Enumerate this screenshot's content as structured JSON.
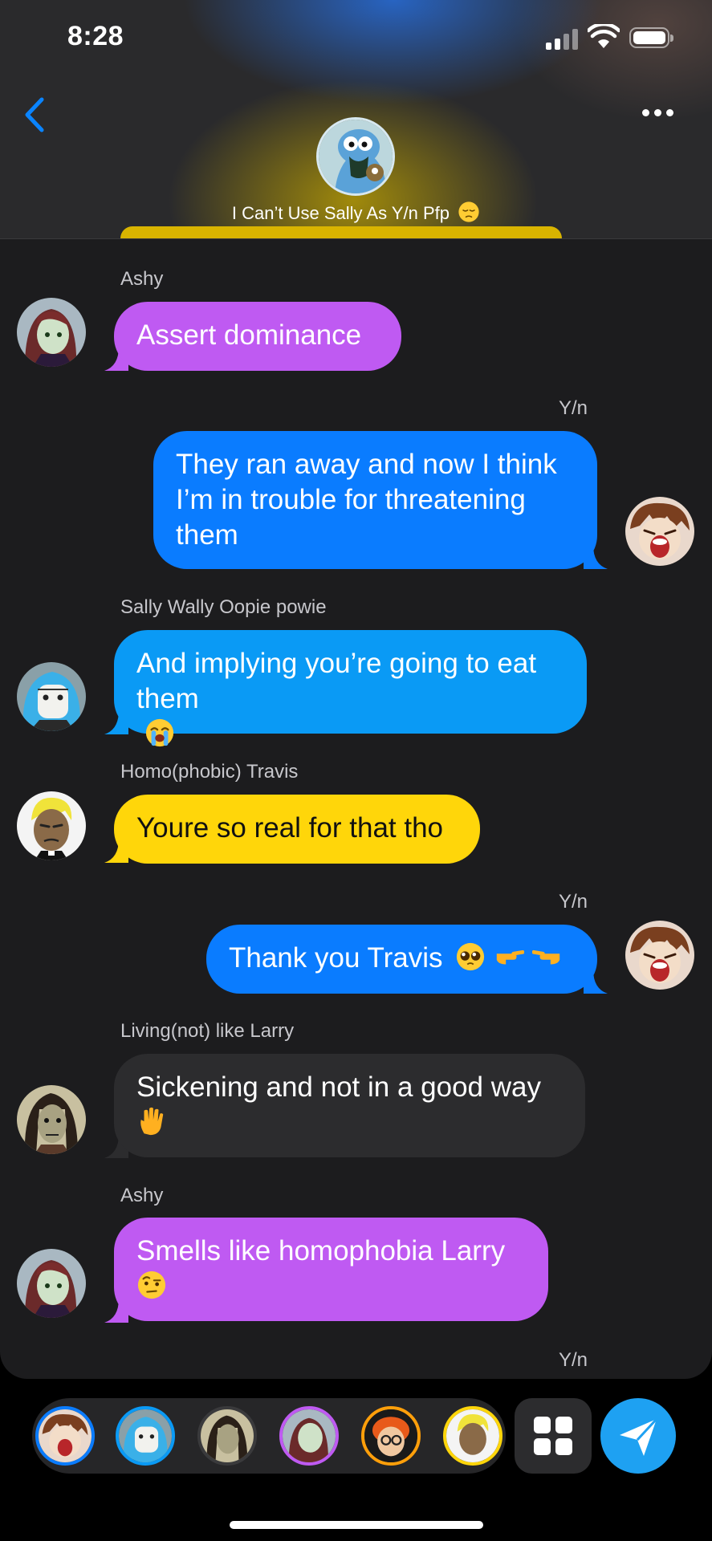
{
  "status_bar": {
    "time": "8:28"
  },
  "header": {
    "group_name": "I Can’t Use Sally As Y/n Pfp",
    "group_name_emoji": "pensive-face-emoji"
  },
  "colors": {
    "purple": "#bf5af2",
    "blue": "#0a7cff",
    "cyan": "#0a9af5",
    "yellow": "#ffd60a",
    "gray": "#2c2c2e",
    "background": "#1c1c1e",
    "send": "#1ea1f2"
  },
  "messages": [
    {
      "sender": "Ashy",
      "text": "Assert dominance",
      "side": "left",
      "color": "purple",
      "avatar": "ashy-avatar"
    },
    {
      "sender": "Y/n",
      "text": "They ran away and now I think\nI’m in trouble for threatening\nthem",
      "side": "right",
      "color": "blue",
      "avatar": "yn-avatar"
    },
    {
      "sender": "Sally Wally Oopie powie",
      "text": "And implying you’re going to eat\nthem",
      "emoji": "loudly-crying-face-emoji",
      "side": "left",
      "color": "cyan",
      "avatar": "sally-avatar"
    },
    {
      "sender": "Homo(phobic) Travis",
      "text": "Youre so real for that tho",
      "side": "left",
      "color": "yellow",
      "avatar": "travis-avatar"
    },
    {
      "sender": "Y/n",
      "text": "Thank you Travis",
      "emoji": "pleading-face-pointing-fingers-emoji",
      "side": "right",
      "color": "blue",
      "avatar": "yn-avatar"
    },
    {
      "sender": "Living(not) like Larry",
      "text": "Sickening and not in a good way",
      "emoji": "raised-hand-emoji",
      "side": "left",
      "color": "gray",
      "avatar": "larry-avatar"
    },
    {
      "sender": "Ashy",
      "text": "Smells like homophobia Larry",
      "emoji": "face-with-raised-eyebrow-emoji",
      "side": "left",
      "color": "purple",
      "avatar": "ashy-avatar"
    }
  ],
  "trailing_sender": "Y/n",
  "bottom_bar": {
    "avatars": [
      "yn-avatar",
      "sally-avatar",
      "larry-avatar",
      "ashy-avatar",
      "neil-avatar",
      "travis-avatar"
    ],
    "grid_icon": "apps-grid-icon",
    "send_icon": "paper-plane-send-icon"
  }
}
